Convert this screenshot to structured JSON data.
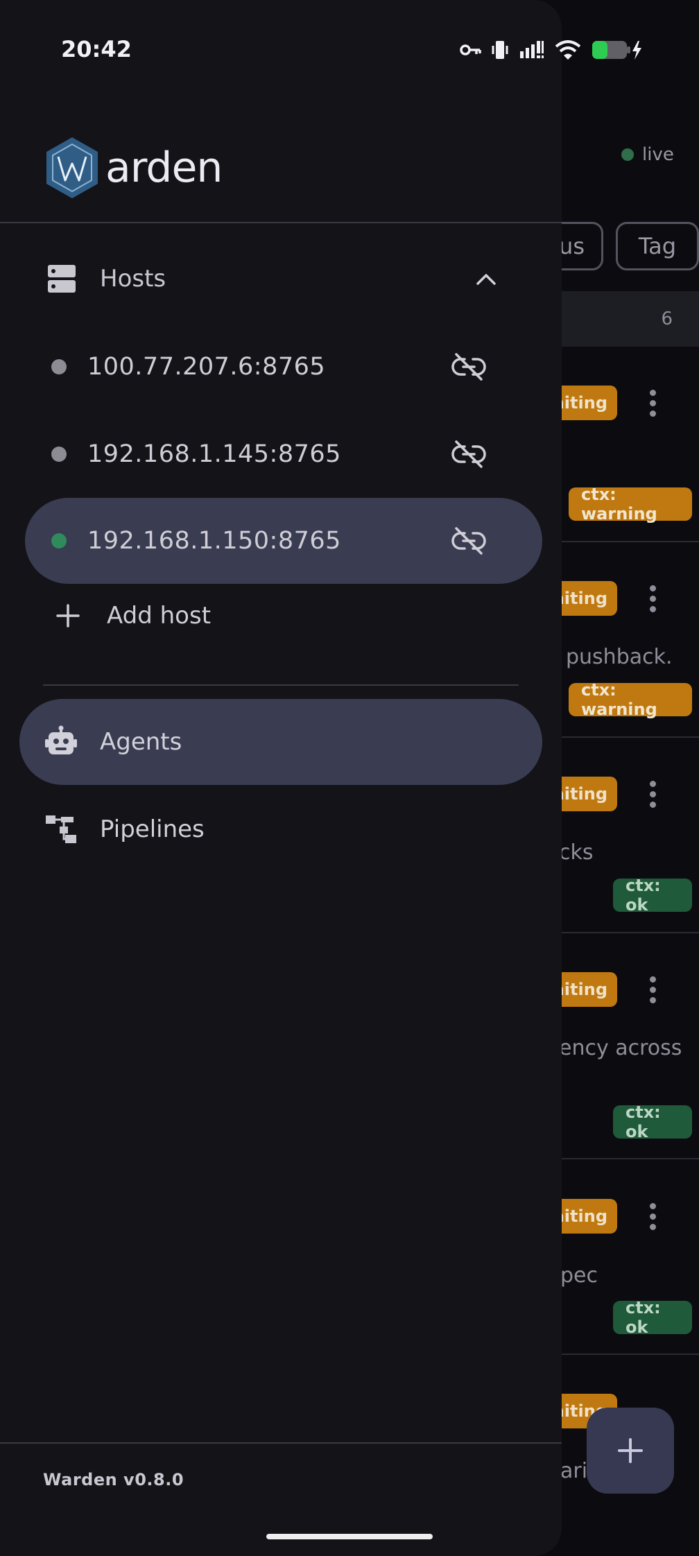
{
  "status_bar": {
    "time": "20:42"
  },
  "brand": {
    "name_suffix": "arden",
    "logo_letter": "W"
  },
  "hosts": {
    "title": "Hosts",
    "items": [
      {
        "address": "100.77.207.6:8765",
        "connected": false,
        "active": false
      },
      {
        "address": "192.168.1.145:8765",
        "connected": false,
        "active": false
      },
      {
        "address": "192.168.1.150:8765",
        "connected": true,
        "active": true
      }
    ],
    "add_label": "Add host"
  },
  "nav": {
    "items": [
      {
        "label": "Agents",
        "icon": "robot-icon",
        "active": true
      },
      {
        "label": "Pipelines",
        "icon": "pipeline-icon",
        "active": false
      }
    ]
  },
  "footer": {
    "version": "Warden v0.8.0"
  },
  "background": {
    "live_label": "live",
    "filter_chips": [
      "us",
      "Tag"
    ],
    "group_count": "6",
    "status_label": "aiting",
    "snippets": [
      "pushback.",
      "cks",
      "ency across",
      "pec",
      "ari"
    ],
    "ctx_warning": "ctx: warning",
    "ctx_ok": "ctx: ok",
    "fab_symbol": "+"
  },
  "colors": {
    "drawer_bg": "#131318",
    "active_pill": "#3a3c52",
    "connected_dot": "#2f8b5c",
    "disconnected_dot": "#8d8c95",
    "warning": "#c07910",
    "ok": "#1f5a3a"
  }
}
